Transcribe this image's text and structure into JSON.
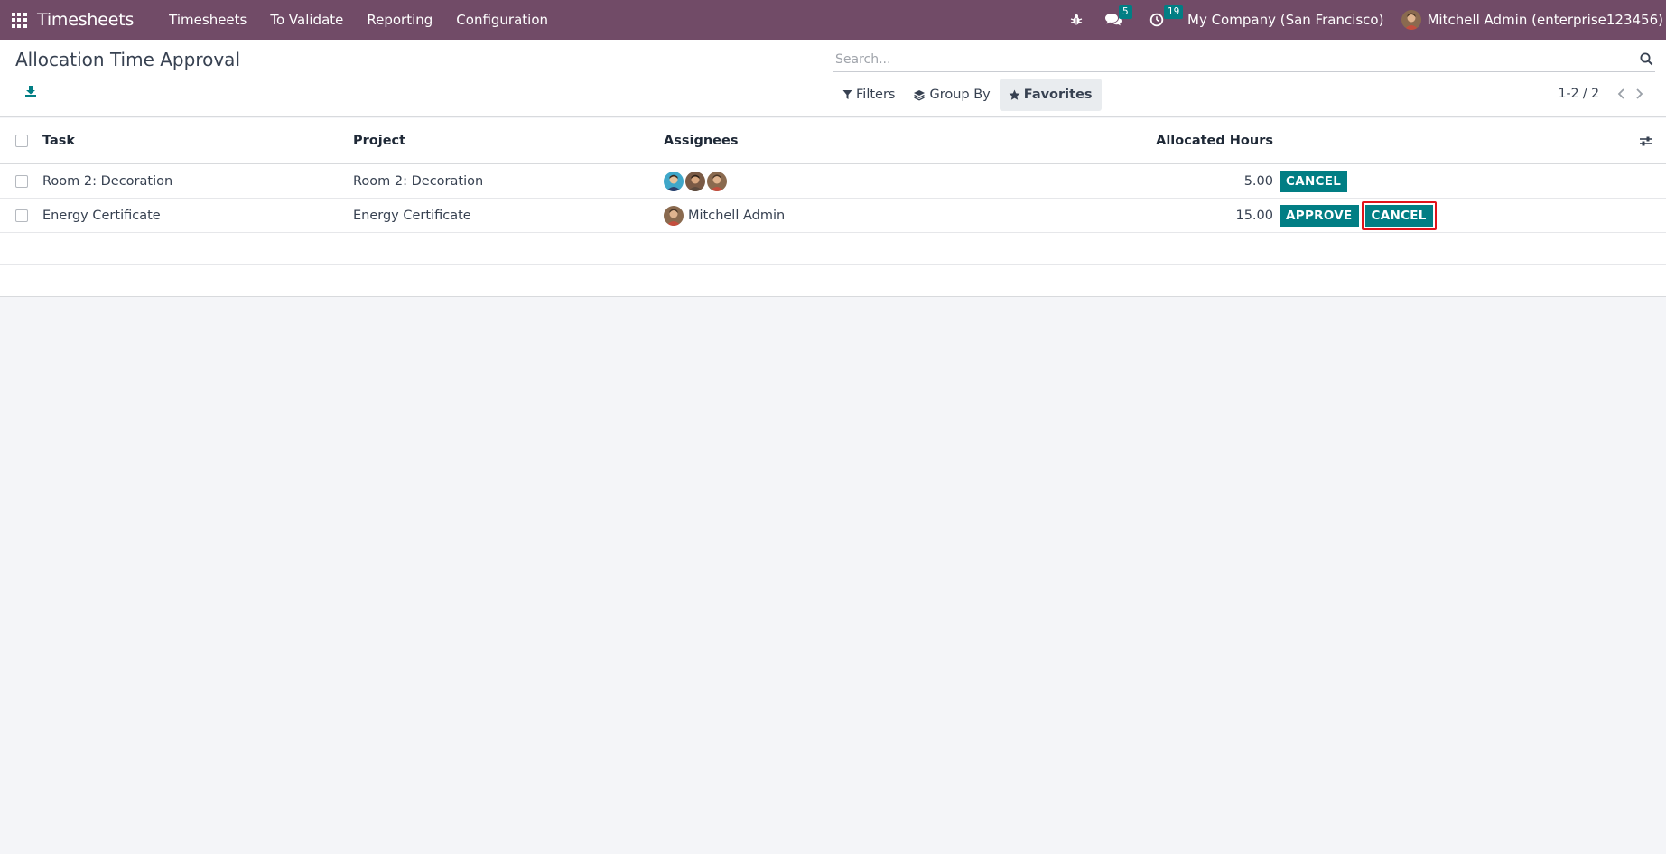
{
  "navbar": {
    "app_title": "Timesheets",
    "menu": [
      "Timesheets",
      "To Validate",
      "Reporting",
      "Configuration"
    ],
    "messages_badge": "5",
    "activities_badge": "19",
    "company": "My Company (San Francisco)",
    "user": "Mitchell Admin (enterprise123456)"
  },
  "control_panel": {
    "title": "Allocation Time Approval",
    "search_placeholder": "Search...",
    "filters_label": "Filters",
    "groupby_label": "Group By",
    "favorites_label": "Favorites",
    "pager": "1-2 / 2"
  },
  "list": {
    "columns": {
      "task": "Task",
      "project": "Project",
      "assignees": "Assignees",
      "allocated_hours": "Allocated Hours"
    },
    "rows": [
      {
        "task": "Room 2: Decoration",
        "project": "Room 2: Decoration",
        "assignees": [],
        "assignee_avatar_count": 3,
        "allocated_hours": "5.00",
        "cancel_label": "CANCEL"
      },
      {
        "task": "Energy Certificate",
        "project": "Energy Certificate",
        "assignees": [
          "Mitchell Admin"
        ],
        "allocated_hours": "15.00",
        "approve_label": "APPROVE",
        "cancel_label": "CANCEL"
      }
    ]
  },
  "colors": {
    "navbar": "#714b67",
    "primary_button": "#017e84",
    "highlight": "#e0131b",
    "background": "#f4f5f8"
  }
}
